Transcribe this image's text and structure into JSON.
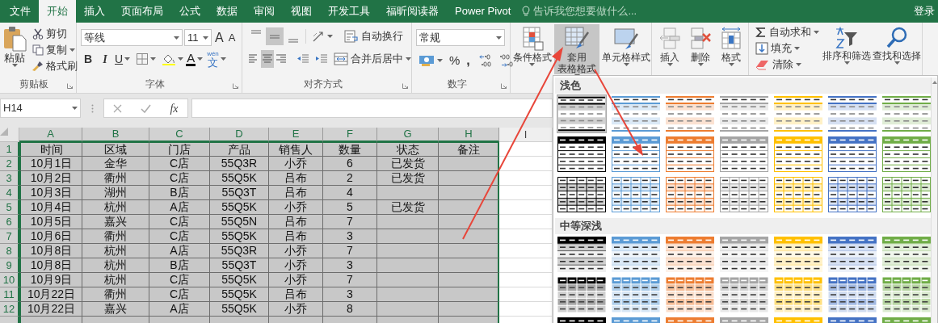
{
  "tabs": [
    {
      "label": "文件",
      "selected": false
    },
    {
      "label": "开始",
      "selected": true
    },
    {
      "label": "插入",
      "selected": false
    },
    {
      "label": "页面布局",
      "selected": false
    },
    {
      "label": "公式",
      "selected": false
    },
    {
      "label": "数据",
      "selected": false
    },
    {
      "label": "审阅",
      "selected": false
    },
    {
      "label": "视图",
      "selected": false
    },
    {
      "label": "开发工具",
      "selected": false
    },
    {
      "label": "福昕阅读器",
      "selected": false
    },
    {
      "label": "Power Pivot",
      "selected": false
    }
  ],
  "tell_me": {
    "placeholder": "告诉我您想要做什么..."
  },
  "sign_in": "登录",
  "ribbon": {
    "clipboard": {
      "paste": "粘贴",
      "cut": "剪切",
      "copy": "复制",
      "format_painter": "格式刷",
      "label": "剪贴板"
    },
    "font": {
      "name": "等线",
      "size": "11",
      "grow": "A",
      "shrink": "A",
      "bold": "B",
      "italic": "I",
      "underline": "U",
      "font_color": "A",
      "phonetic_top": "wén",
      "phonetic": "文",
      "label": "字体"
    },
    "alignment": {
      "vertical": [
        {
          "selected": false
        },
        {
          "selected": true
        },
        {
          "selected": false
        }
      ],
      "horizontal": [
        {
          "selected": false
        },
        {
          "selected": true
        },
        {
          "selected": false
        }
      ],
      "wrap": "自动换行",
      "merge": "合并后居中",
      "label": "对齐方式"
    },
    "number": {
      "format": "常规",
      "percent": "%",
      "comma": ",",
      "label": "数字"
    },
    "styles": {
      "conditional": "条件格式",
      "table_line1": "套用",
      "table_line2": "表格格式",
      "table_pressed": true,
      "cell_styles": "单元格样式"
    },
    "cells": {
      "insert": "插入",
      "delete": "删除",
      "format": "格式"
    },
    "editing": {
      "autosum": "自动求和",
      "fill": "填充",
      "clear": "清除",
      "sort": "排序和筛选",
      "find": "查找和选择"
    }
  },
  "formula_bar": {
    "name_box": "H14",
    "fx": "fx"
  },
  "sheet": {
    "columns": [
      {
        "letter": "A",
        "selected": true
      },
      {
        "letter": "B",
        "selected": true
      },
      {
        "letter": "C",
        "selected": true
      },
      {
        "letter": "D",
        "selected": true
      },
      {
        "letter": "E",
        "selected": true
      },
      {
        "letter": "F",
        "selected": true
      },
      {
        "letter": "G",
        "selected": true
      },
      {
        "letter": "H",
        "selected": true
      },
      {
        "letter": "I",
        "selected": false
      }
    ],
    "rows": [
      {
        "number": "1",
        "selected": true,
        "cells": [
          "时间",
          "区域",
          "门店",
          "产品",
          "销售人",
          "数量",
          "状态",
          "备注"
        ]
      },
      {
        "number": "2",
        "selected": true,
        "cells": [
          "10月1日",
          "金华",
          "C店",
          "55Q3R",
          "小乔",
          "6",
          "已发货",
          null
        ]
      },
      {
        "number": "3",
        "selected": true,
        "cells": [
          "10月2日",
          "衢州",
          "C店",
          "55Q5K",
          "吕布",
          "2",
          "已发货",
          null
        ]
      },
      {
        "number": "4",
        "selected": true,
        "cells": [
          "10月3日",
          "湖州",
          "B店",
          "55Q3T",
          "吕布",
          "4",
          null,
          null
        ]
      },
      {
        "number": "5",
        "selected": true,
        "cells": [
          "10月4日",
          "杭州",
          "A店",
          "55Q5K",
          "小乔",
          "5",
          "已发货",
          null
        ]
      },
      {
        "number": "6",
        "selected": true,
        "cells": [
          "10月5日",
          "嘉兴",
          "C店",
          "55Q5N",
          "吕布",
          "7",
          null,
          null
        ]
      },
      {
        "number": "7",
        "selected": true,
        "cells": [
          "10月6日",
          "衢州",
          "C店",
          "55Q5K",
          "吕布",
          "3",
          null,
          null
        ]
      },
      {
        "number": "8",
        "selected": true,
        "cells": [
          "10月8日",
          "杭州",
          "A店",
          "55Q3R",
          "小乔",
          "7",
          null,
          null
        ]
      },
      {
        "number": "9",
        "selected": true,
        "cells": [
          "10月8日",
          "杭州",
          "B店",
          "55Q3T",
          "小乔",
          "3",
          null,
          null
        ]
      },
      {
        "number": "10",
        "selected": true,
        "cells": [
          "10月9日",
          "杭州",
          "C店",
          "55Q5K",
          "小乔",
          "7",
          null,
          null
        ]
      },
      {
        "number": "11",
        "selected": true,
        "cells": [
          "10月22日",
          "衢州",
          "C店",
          "55Q5K",
          "吕布",
          "3",
          null,
          null
        ]
      },
      {
        "number": "12",
        "selected": true,
        "cells": [
          "10月22日",
          "嘉兴",
          "A店",
          "55Q5K",
          "小乔",
          "8",
          null,
          null
        ]
      }
    ]
  },
  "gallery": {
    "sections": [
      {
        "title": "浅色",
        "rows": [
          {
            "kind": "light",
            "styles": [
              {
                "color": "#000000",
                "selected": true
              },
              {
                "color": "#5b9bd5",
                "selected": false
              },
              {
                "color": "#ed7d31",
                "selected": false
              },
              {
                "color": "#a5a5a5",
                "selected": false
              },
              {
                "color": "#ffc000",
                "selected": false
              },
              {
                "color": "#4472c4",
                "selected": false
              },
              {
                "color": "#70ad47",
                "selected": false
              }
            ]
          },
          {
            "kind": "header",
            "styles": [
              {
                "color": "#000000",
                "selected": false
              },
              {
                "color": "#5b9bd5",
                "selected": false
              },
              {
                "color": "#ed7d31",
                "selected": false
              },
              {
                "color": "#a5a5a5",
                "selected": false
              },
              {
                "color": "#ffc000",
                "selected": false
              },
              {
                "color": "#4472c4",
                "selected": false
              },
              {
                "color": "#70ad47",
                "selected": false
              }
            ]
          },
          {
            "kind": "grid",
            "styles": [
              {
                "color": "#000000",
                "selected": false
              },
              {
                "color": "#5b9bd5",
                "selected": false
              },
              {
                "color": "#ed7d31",
                "selected": false
              },
              {
                "color": "#a5a5a5",
                "selected": false
              },
              {
                "color": "#ffc000",
                "selected": false
              },
              {
                "color": "#4472c4",
                "selected": false
              },
              {
                "color": "#70ad47",
                "selected": false
              }
            ]
          }
        ]
      },
      {
        "title": "中等深浅",
        "rows": [
          {
            "kind": "medium",
            "styles": [
              {
                "color": "#000000",
                "selected": false
              },
              {
                "color": "#5b9bd5",
                "selected": false
              },
              {
                "color": "#ed7d31",
                "selected": false
              },
              {
                "color": "#a5a5a5",
                "selected": false
              },
              {
                "color": "#ffc000",
                "selected": false
              },
              {
                "color": "#4472c4",
                "selected": false
              },
              {
                "color": "#70ad47",
                "selected": false
              }
            ]
          },
          {
            "kind": "banded",
            "styles": [
              {
                "color": "#000000",
                "selected": false
              },
              {
                "color": "#5b9bd5",
                "selected": false
              },
              {
                "color": "#ed7d31",
                "selected": false
              },
              {
                "color": "#a5a5a5",
                "selected": false
              },
              {
                "color": "#ffc000",
                "selected": false
              },
              {
                "color": "#4472c4",
                "selected": false
              },
              {
                "color": "#70ad47",
                "selected": false
              }
            ]
          },
          {
            "kind": "medium",
            "styles": [
              {
                "color": "#000000",
                "selected": false
              },
              {
                "color": "#5b9bd5",
                "selected": false
              },
              {
                "color": "#ed7d31",
                "selected": false
              },
              {
                "color": "#a5a5a5",
                "selected": false
              },
              {
                "color": "#ffc000",
                "selected": false
              },
              {
                "color": "#4472c4",
                "selected": false
              },
              {
                "color": "#70ad47",
                "selected": false
              }
            ]
          }
        ]
      }
    ]
  }
}
